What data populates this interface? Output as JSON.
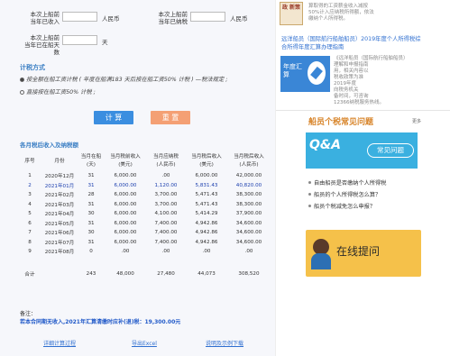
{
  "form": {
    "field1_label_line1": "本次上船前",
    "field1_label_line2": "当年已收入",
    "field1_unit": "人民币",
    "field2_label_line1": "本次上船前",
    "field2_label_line2": "当年已纳税",
    "field2_unit": "人民币",
    "field3_label": "本次上船前",
    "field3_label_line2": "当年已在船天数",
    "field3_unit": "天"
  },
  "method": {
    "title": "计税方式",
    "option1": "按全额在船工资计税 ( 年度在船满183 天后按在船工资50% 计税 ) —税法规定 ;",
    "option2": "直接按在船工资50% 计税 ;"
  },
  "buttons": {
    "calc": "计 算",
    "reset": "重 置"
  },
  "table": {
    "title": "各月税后收入及纳税额",
    "headers": [
      [
        "序号",
        ""
      ],
      [
        "月份",
        ""
      ],
      [
        "当月在船",
        "(天)"
      ],
      [
        "当月税前收入",
        "(美元)"
      ],
      [
        "当月应纳税",
        "(人民币)"
      ],
      [
        "当月税后收入",
        "(美元)"
      ],
      [
        "当月税后收入",
        "(人民币)"
      ]
    ],
    "rows": [
      [
        "1",
        "2020年12月",
        "31",
        "6,000.00",
        ".00",
        "6,000.00",
        "42,000.00"
      ],
      [
        "2",
        "2021年01月",
        "31",
        "6,000.00",
        "1,120.00",
        "5,831.43",
        "40,820.00"
      ],
      [
        "3",
        "2021年02月",
        "28",
        "6,000.00",
        "3,700.00",
        "5,471.43",
        "38,300.00"
      ],
      [
        "4",
        "2021年03月",
        "31",
        "6,000.00",
        "3,700.00",
        "5,471.43",
        "38,300.00"
      ],
      [
        "5",
        "2021年04月",
        "30",
        "6,000.00",
        "4,100.00",
        "5,414.29",
        "37,900.00"
      ],
      [
        "6",
        "2021年05月",
        "31",
        "6,000.00",
        "7,400.00",
        "4,942.86",
        "34,600.00"
      ],
      [
        "7",
        "2021年06月",
        "30",
        "6,000.00",
        "7,400.00",
        "4,942.86",
        "34,600.00"
      ],
      [
        "8",
        "2021年07月",
        "31",
        "6,000.00",
        "7,400.00",
        "4,942.86",
        "34,600.00"
      ],
      [
        "9",
        "2021年08月",
        "0",
        ".00",
        ".00",
        ".00",
        ".00"
      ]
    ],
    "total": [
      "合计",
      "",
      "243",
      "48,000",
      "27,480",
      "44,073",
      "308,520"
    ]
  },
  "note": {
    "label": "备注：",
    "text": "若本合同期无收入,2021年汇算清缴时应补(退)税：19,300.00元"
  },
  "links": {
    "detail": "详细计算过程",
    "export": "导出Excel",
    "help": "说明及示例下载"
  },
  "right": {
    "top_lines": [
      "算取得的工资薪金收入减按",
      "50%计入应纳税所得额，依法",
      "缴纳个人所得税。"
    ],
    "notice_badge": "政 新策",
    "article_title": "远洋船员（国际航行船舶船员）2019年度个人所得税综合所得年度汇算办理指南",
    "article_img": "年度汇算",
    "article_desc": [
      "《远洋船员（国际航行船舶船员）",
      "理解和申报指南",
      "用，相关内容以",
      "税收政策为准",
      "2019年度",
      "向税务机关",
      "备时间，可咨询",
      "12366纳税服务热线。"
    ],
    "faq_title": "船员个税常见问题",
    "more": "更多",
    "banner_main": "Q&A",
    "banner_sub": "常见问题",
    "faq_items": [
      "自由船员是否缴纳个人所得税",
      "船员的个人所得税怎么算？",
      "船员个税减免怎么申报？"
    ],
    "online_btn": "在线提问"
  }
}
